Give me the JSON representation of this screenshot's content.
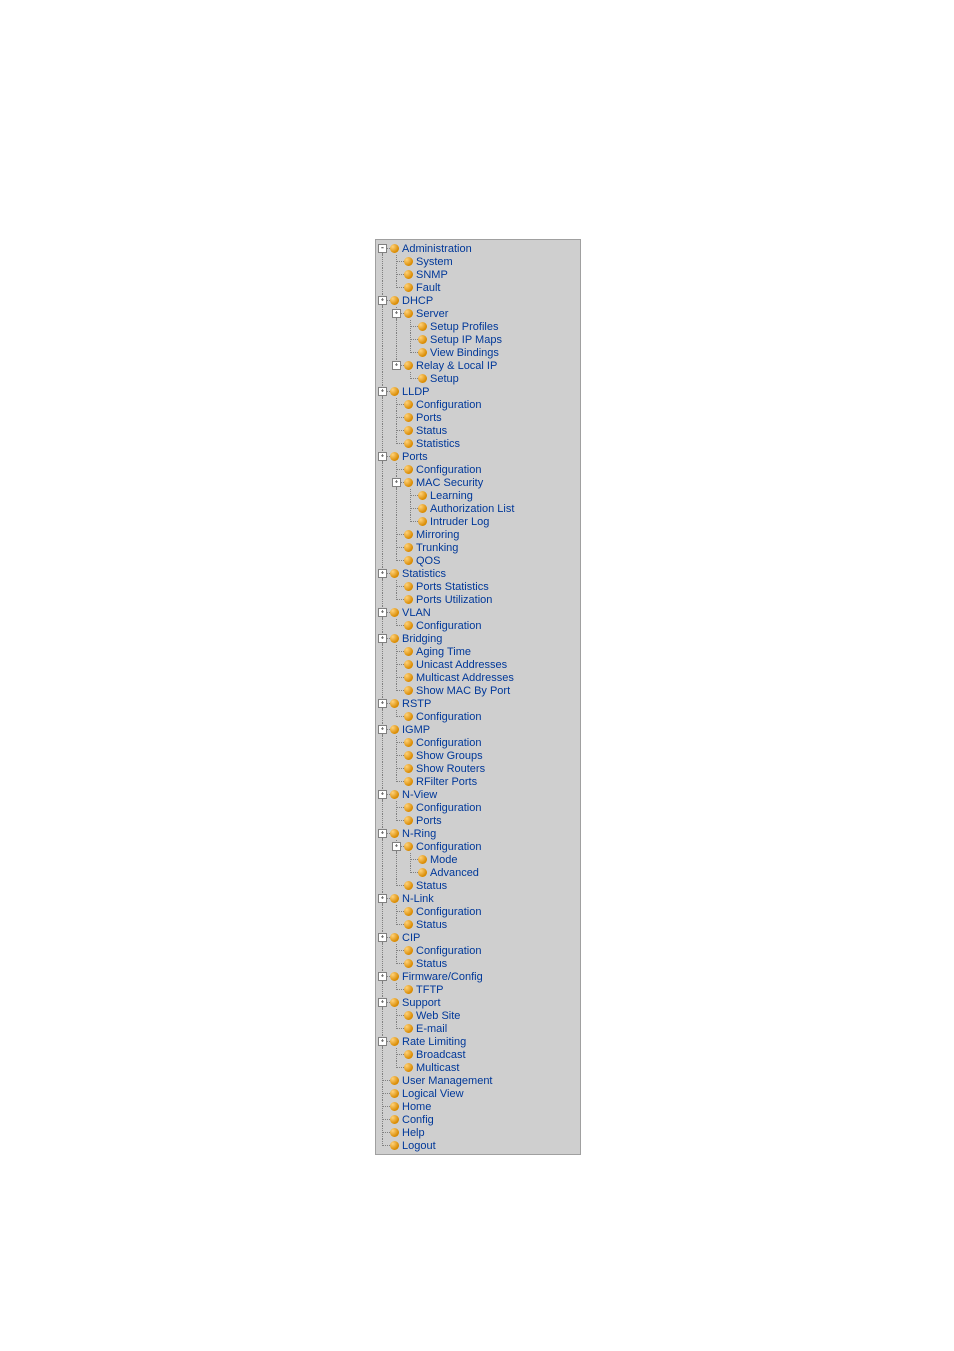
{
  "tree": [
    {
      "d": 0,
      "box": "-",
      "label": "Administration"
    },
    {
      "d": 1,
      "leaf": true,
      "label": "System"
    },
    {
      "d": 1,
      "leaf": true,
      "label": "SNMP"
    },
    {
      "d": 1,
      "leaf": true,
      "last": true,
      "label": "Fault"
    },
    {
      "d": 0,
      "box": "-",
      "label": "DHCP"
    },
    {
      "d": 1,
      "box": "-",
      "label": "Server"
    },
    {
      "d": 2,
      "leaf": true,
      "label": "Setup Profiles"
    },
    {
      "d": 2,
      "leaf": true,
      "label": "Setup IP Maps"
    },
    {
      "d": 2,
      "leaf": true,
      "last": true,
      "label": "View Bindings"
    },
    {
      "d": 1,
      "box": "-",
      "last": true,
      "label": "Relay & Local IP"
    },
    {
      "d": 2,
      "leaf": true,
      "last": true,
      "label": "Setup"
    },
    {
      "d": 0,
      "box": "-",
      "label": "LLDP"
    },
    {
      "d": 1,
      "leaf": true,
      "label": "Configuration"
    },
    {
      "d": 1,
      "leaf": true,
      "label": "Ports"
    },
    {
      "d": 1,
      "leaf": true,
      "label": "Status"
    },
    {
      "d": 1,
      "leaf": true,
      "last": true,
      "label": "Statistics"
    },
    {
      "d": 0,
      "box": "-",
      "label": "Ports"
    },
    {
      "d": 1,
      "leaf": true,
      "label": "Configuration"
    },
    {
      "d": 1,
      "box": "-",
      "label": "MAC Security"
    },
    {
      "d": 2,
      "leaf": true,
      "label": "Learning"
    },
    {
      "d": 2,
      "leaf": true,
      "label": "Authorization List"
    },
    {
      "d": 2,
      "leaf": true,
      "last": true,
      "label": "Intruder Log"
    },
    {
      "d": 1,
      "leaf": true,
      "label": "Mirroring"
    },
    {
      "d": 1,
      "leaf": true,
      "label": "Trunking"
    },
    {
      "d": 1,
      "leaf": true,
      "last": true,
      "label": "QOS"
    },
    {
      "d": 0,
      "box": "-",
      "label": "Statistics"
    },
    {
      "d": 1,
      "leaf": true,
      "label": "Ports Statistics"
    },
    {
      "d": 1,
      "leaf": true,
      "last": true,
      "label": "Ports Utilization"
    },
    {
      "d": 0,
      "box": "-",
      "label": "VLAN"
    },
    {
      "d": 1,
      "leaf": true,
      "last": true,
      "label": "Configuration"
    },
    {
      "d": 0,
      "box": "-",
      "label": "Bridging"
    },
    {
      "d": 1,
      "leaf": true,
      "label": "Aging Time"
    },
    {
      "d": 1,
      "leaf": true,
      "label": "Unicast Addresses"
    },
    {
      "d": 1,
      "leaf": true,
      "label": "Multicast Addresses"
    },
    {
      "d": 1,
      "leaf": true,
      "last": true,
      "label": "Show MAC By Port"
    },
    {
      "d": 0,
      "box": "-",
      "label": "RSTP"
    },
    {
      "d": 1,
      "leaf": true,
      "last": true,
      "label": "Configuration"
    },
    {
      "d": 0,
      "box": "-",
      "label": "IGMP"
    },
    {
      "d": 1,
      "leaf": true,
      "label": "Configuration"
    },
    {
      "d": 1,
      "leaf": true,
      "label": "Show Groups"
    },
    {
      "d": 1,
      "leaf": true,
      "label": "Show Routers"
    },
    {
      "d": 1,
      "leaf": true,
      "last": true,
      "label": "RFilter Ports"
    },
    {
      "d": 0,
      "box": "-",
      "label": "N-View"
    },
    {
      "d": 1,
      "leaf": true,
      "label": "Configuration"
    },
    {
      "d": 1,
      "leaf": true,
      "last": true,
      "label": "Ports"
    },
    {
      "d": 0,
      "box": "-",
      "label": "N-Ring"
    },
    {
      "d": 1,
      "box": "-",
      "label": "Configuration"
    },
    {
      "d": 2,
      "leaf": true,
      "label": "Mode"
    },
    {
      "d": 2,
      "leaf": true,
      "last": true,
      "label": "Advanced"
    },
    {
      "d": 1,
      "leaf": true,
      "last": true,
      "label": "Status"
    },
    {
      "d": 0,
      "box": "-",
      "label": "N-Link"
    },
    {
      "d": 1,
      "leaf": true,
      "label": "Configuration"
    },
    {
      "d": 1,
      "leaf": true,
      "last": true,
      "label": "Status"
    },
    {
      "d": 0,
      "box": "-",
      "label": "CIP"
    },
    {
      "d": 1,
      "leaf": true,
      "label": "Configuration"
    },
    {
      "d": 1,
      "leaf": true,
      "last": true,
      "label": "Status"
    },
    {
      "d": 0,
      "box": "-",
      "label": "Firmware/Config"
    },
    {
      "d": 1,
      "leaf": true,
      "last": true,
      "label": "TFTP"
    },
    {
      "d": 0,
      "box": "-",
      "label": "Support"
    },
    {
      "d": 1,
      "leaf": true,
      "label": "Web Site"
    },
    {
      "d": 1,
      "leaf": true,
      "last": true,
      "label": "E-mail"
    },
    {
      "d": 0,
      "box": "-",
      "label": "Rate Limiting"
    },
    {
      "d": 1,
      "leaf": true,
      "label": "Broadcast"
    },
    {
      "d": 1,
      "leaf": true,
      "last": true,
      "label": "Multicast"
    },
    {
      "d": 0,
      "leaf": true,
      "label": "User Management"
    },
    {
      "d": 0,
      "leaf": true,
      "label": "Logical View"
    },
    {
      "d": 0,
      "leaf": true,
      "label": "Home"
    },
    {
      "d": 0,
      "leaf": true,
      "label": "Config"
    },
    {
      "d": 0,
      "leaf": true,
      "label": "Help"
    },
    {
      "d": 0,
      "leaf": true,
      "last": true,
      "label": "Logout"
    }
  ]
}
